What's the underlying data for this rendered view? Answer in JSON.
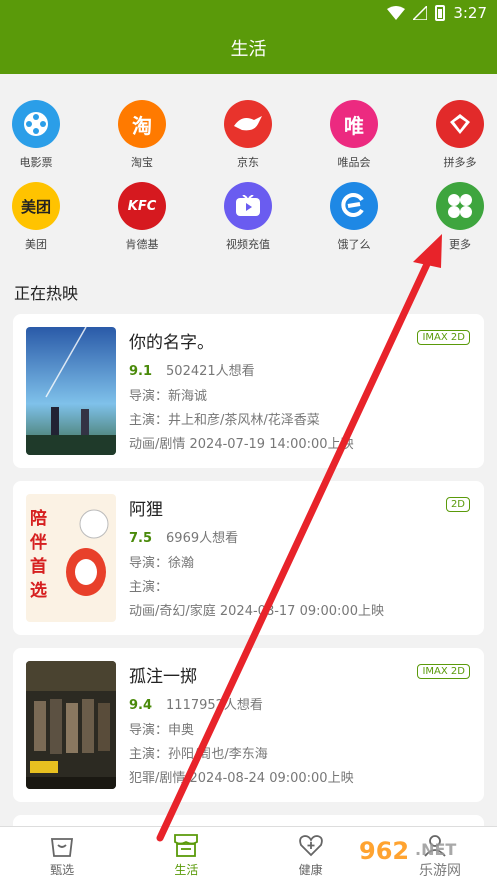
{
  "status_bar": {
    "time": "3:27"
  },
  "app_bar": {
    "title": "生活"
  },
  "services": [
    {
      "label": "电影票",
      "icon": "film-reel-icon",
      "color": "#2b9ee8",
      "glyph": ""
    },
    {
      "label": "淘宝",
      "icon": "taobao-icon",
      "color": "#ff7a00",
      "glyph": "淘"
    },
    {
      "label": "京东",
      "icon": "jd-dog-icon",
      "color": "#e8332c",
      "glyph": ""
    },
    {
      "label": "唯品会",
      "icon": "vip-icon",
      "color": "#ec2a80",
      "glyph": "唯"
    },
    {
      "label": "拼多多",
      "icon": "pinduoduo-icon",
      "color": "#e22a2a",
      "glyph": ""
    },
    {
      "label": "美团",
      "icon": "meituan-icon",
      "color": "#ffc300",
      "glyph": "美团"
    },
    {
      "label": "肯德基",
      "icon": "kfc-icon",
      "color": "#d6191f",
      "glyph": "KFC"
    },
    {
      "label": "视频充值",
      "icon": "video-play-icon",
      "color": "#6a5cf0",
      "glyph": ""
    },
    {
      "label": "饿了么",
      "icon": "eleme-icon",
      "color": "#1e88e5",
      "glyph": ""
    },
    {
      "label": "更多",
      "icon": "more-grid-icon",
      "color": "#3ea53e",
      "glyph": ""
    }
  ],
  "section_title": "正在热映",
  "movies": [
    {
      "title": "你的名字。",
      "badge": "IMAX 2D",
      "score": "9.1",
      "wants": "502421人想看",
      "director": "导演：新海诚",
      "cast": "主演：井上和彦/茶风林/花泽香菜",
      "info": "动画/剧情   2024-07-19 14:00:00上映"
    },
    {
      "title": "阿狸",
      "badge": "2D",
      "score": "7.5",
      "wants": "6969人想看",
      "director": "导演：徐瀚",
      "cast": "主演：",
      "info": "动画/奇幻/家庭   2024-08-17 09:00:00上映"
    },
    {
      "title": "孤注一掷",
      "badge": "IMAX 2D",
      "score": "9.4",
      "wants": "1117952人想看",
      "director": "导演：申奥",
      "cast": "主演：孙阳/周也/李东海",
      "info": "犯罪/剧情   2024-08-24 09:00:00上映"
    }
  ],
  "tabs": [
    {
      "label": "甄选",
      "icon": "shopping-bag-icon"
    },
    {
      "label": "生活",
      "icon": "store-icon"
    },
    {
      "label": "健康",
      "icon": "heart-plus-icon"
    },
    {
      "label": "",
      "icon": "user-icon"
    }
  ],
  "watermark": {
    "brand": "962.NET",
    "sub": "乐游网"
  }
}
